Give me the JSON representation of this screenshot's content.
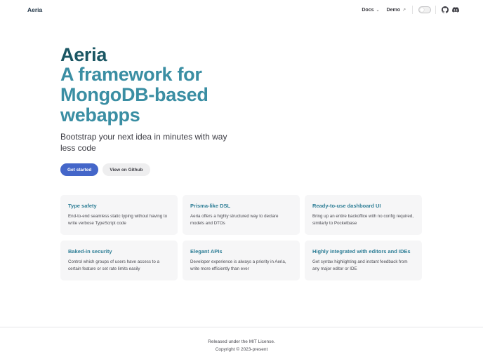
{
  "nav": {
    "brand": "Aeria",
    "docs_label": "Docs",
    "demo_label": "Demo"
  },
  "hero": {
    "name": "Aeria",
    "text": "A framework for MongoDB-based webapps",
    "tagline": "Bootstrap your next idea in minutes with way less code",
    "primary_action": "Get started",
    "alt_action": "View on Github"
  },
  "features": [
    {
      "title": "Type safety",
      "details": "End-to-end seamless static typing without having to write verbose TypeScript code"
    },
    {
      "title": "Prisma-like DSL",
      "details": "Aeria offers a highly structured way to declare models and DTOs"
    },
    {
      "title": "Ready-to-use dashboard UI",
      "details": "Bring up an entire backoffice with no config required, similarly to Pocketbase"
    },
    {
      "title": "Baked-in security",
      "details": "Control which groups of users have access to a certain feature or set rate limits easily"
    },
    {
      "title": "Elegant APIs",
      "details": "Developer experience is always a priority in Aeria, write more efficiently than ever"
    },
    {
      "title": "Highly integrated with editors and IDEs",
      "details": "Get syntax highlighting and instant feedback from any major editor or IDE"
    }
  ],
  "footer": {
    "message": "Released under the MIT License.",
    "copyright": "Copyright © 2023-present"
  },
  "icons": {
    "docs_menu": "chevron-down-icon",
    "demo_link": "external-link-icon",
    "theme": "appearance-toggle",
    "github": "github-icon",
    "discord": "discord-icon"
  },
  "colors": {
    "brand": "#3a8ea3",
    "brand_dark": "#1a5663",
    "primary_button": "#4466c9"
  }
}
